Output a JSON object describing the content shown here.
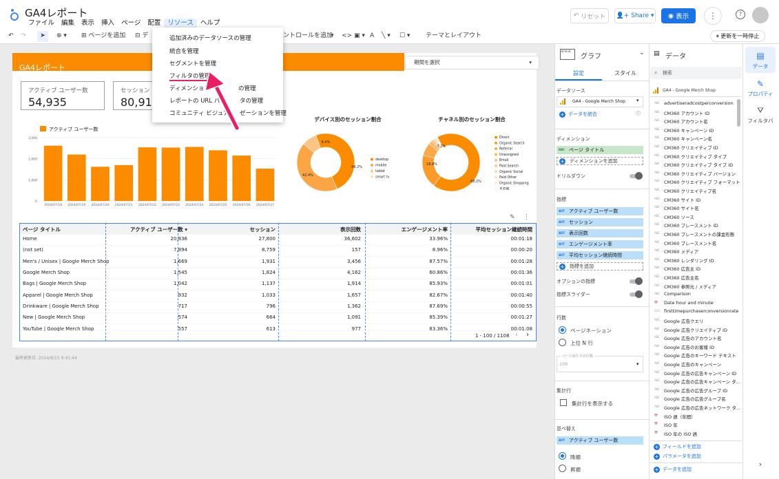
{
  "app": {
    "title": "GA4レポート",
    "menu": [
      "ファイル",
      "編集",
      "表示",
      "挿入",
      "ページ",
      "配置",
      "リソース",
      "ヘルプ"
    ],
    "reset_label": "リセット",
    "share_label": "Share",
    "view_label": "表示",
    "help_icon": "?"
  },
  "toolbar": {
    "add_page": "ページを追加",
    "add_control": "ントロールを追加",
    "theme_layout": "テーマとレイアウト",
    "pause_updates": "更新を一時停止"
  },
  "dropdown": {
    "items": [
      "追加済みのデータソースの管理",
      "統合を管理",
      "セグメントを管理",
      "フィルタの管理",
      "ディメンション",
      "の管理",
      "レポートの URL パ",
      "タの管理",
      "コミュニティ ビジュア",
      "ゼーションを管理"
    ],
    "highlighted_index": 3
  },
  "report": {
    "title": "GA4レポート",
    "date_select": "期間を選択",
    "scorecards": [
      {
        "label": "アクティブ ユーザー数",
        "value": "54,935"
      },
      {
        "label": "セッション",
        "value": "80,914"
      }
    ],
    "last_updated": "最終更新日: 2024/8/15 9:41:44"
  },
  "chart_data": [
    {
      "type": "bar",
      "categories": [
        "2024/07/18",
        "2024/07/19",
        "2024/07/20",
        "2024/07/21",
        "2024/07/22",
        "2024/07/23",
        "2024/07/24",
        "2024/07/25",
        "2024/07/26",
        "2024/07/27"
      ],
      "series": [
        {
          "name": "アクティブ ユーザー数",
          "values": [
            2620,
            2200,
            1620,
            1700,
            2540,
            2530,
            2560,
            2400,
            2150,
            1530
          ]
        }
      ],
      "ylim": [
        0,
        3000
      ],
      "yticks": [
        "3,000",
        "2,000",
        "1,000",
        "0"
      ],
      "color": "#fb8c00"
    },
    {
      "type": "pie",
      "title": "デバイス別のセッション割合",
      "labels": [
        "desktop",
        "mobile",
        "tablet",
        "smart tv"
      ],
      "values": [
        49.2,
        42.4,
        8.4,
        0.0
      ],
      "value_labels": [
        "49.2%",
        "42.4%",
        "8.4%"
      ],
      "colors": [
        "#fb8c00",
        "#fba545",
        "#fbc384",
        "#fde0bf"
      ]
    },
    {
      "type": "pie",
      "title": "チャネル別のセッション割合",
      "labels": [
        "Direct",
        "Organic Search",
        "Referral",
        "Unassigned",
        "Email",
        "Paid Search",
        "Organic Social",
        "Paid Other",
        "Organic Shopping",
        "その他"
      ],
      "values": [
        68.2,
        18.8,
        7.2,
        2.0,
        1.2,
        1.0,
        0.7,
        0.4,
        0.3,
        0.2
      ],
      "value_labels": [
        "68.2%",
        "18.8%",
        "7.2%"
      ],
      "colors": [
        "#fb8c00",
        "#fc9a2a",
        "#fca846",
        "#fcb562",
        "#fcc17c",
        "#fccc94",
        "#fdd7aa",
        "#fde1bf",
        "#fdebd3",
        "#fef4e7"
      ]
    }
  ],
  "table": {
    "headers": [
      "ページ タイトル",
      "アクティブ ユーザー数 ▾",
      "セッション",
      "表示回数",
      "エンゲージメント率",
      "平均セッション継続時間"
    ],
    "rows": [
      [
        "Home",
        "20,836",
        "27,800",
        "36,602",
        "33.96%",
        "00:01:18"
      ],
      [
        "(not set)",
        "7,894",
        "8,759",
        "157",
        "8.96%",
        "00:00:20"
      ],
      [
        "Men's / Unisex | Google Merch Shop",
        "1,669",
        "1,931",
        "3,456",
        "87.57%",
        "00:01:28"
      ],
      [
        "Google Merch Shop",
        "1,545",
        "1,824",
        "4,162",
        "60.86%",
        "00:01:36"
      ],
      [
        "Bags | Google Merch Shop",
        "1,042",
        "1,137",
        "1,914",
        "85.93%",
        "00:01:01"
      ],
      [
        "Apparel | Google Merch Shop",
        "932",
        "1,033",
        "1,657",
        "82.67%",
        "00:01:40"
      ],
      [
        "Drinkware | Google Merch Shop",
        "717",
        "796",
        "1,362",
        "87.69%",
        "00:00:55"
      ],
      [
        "New | Google Merch Shop",
        "574",
        "664",
        "1,091",
        "85.39%",
        "00:01:27"
      ],
      [
        "YouTube | Google Merch Shop",
        "557",
        "613",
        "977",
        "83.36%",
        "00:01:08"
      ]
    ],
    "pagination": "1 - 100 / 1108"
  },
  "chart_panel": {
    "title": "グラフ",
    "tabs": [
      "設定",
      "スタイル"
    ],
    "data_source_label": "データソース",
    "data_source": "GA4 - Google Merch Shop",
    "blend_label": "データを統合",
    "dimension_label": "ディメンション",
    "dimension_chip": "ページ タイトル",
    "add_dimension": "ディメンションを追加",
    "drilldown": "ドリルダウン",
    "metrics_label": "指標",
    "metric_chips": [
      "アクティブ ユーザー数",
      "セッション",
      "表示回数",
      "エンゲージメント率",
      "平均セッション継続時間"
    ],
    "add_metric": "指標を追加",
    "optional_metrics": "オプションの指標",
    "metric_slider": "指標スライダー",
    "rows_label": "行数",
    "pagination_opt": "ページネーション",
    "top_n_opt": "上位 N 行",
    "rows_per_page_label": "ページあたりの行数",
    "rows_per_page": "100",
    "summary_label": "集計行",
    "show_summary": "集計行を表示する",
    "sort_label": "並べ替え",
    "sort_chip": "アクティブ ユーザー数",
    "desc": "降順",
    "asc": "昇順"
  },
  "data_panel": {
    "title": "データ",
    "search_placeholder": "検索",
    "source": "GA4 - Google Merch Shop",
    "fields": [
      [
        "ABC",
        "advertiseradcostperconversion"
      ],
      [
        "ABC",
        "CM360 アカウント ID"
      ],
      [
        "ABC",
        "CM360 アカウント名"
      ],
      [
        "ABC",
        "CM360 キャンペーン ID"
      ],
      [
        "ABC",
        "CM360 キャンペーン名"
      ],
      [
        "ABC",
        "CM360 クリエイティブ ID"
      ],
      [
        "ABC",
        "CM360 クリエイティブ タイプ"
      ],
      [
        "ABC",
        "CM360 クリエイティブ タイプ ID"
      ],
      [
        "ABC",
        "CM360 クリエイティブ バージョン"
      ],
      [
        "ABC",
        "CM360 クリエイティブ フォーマット"
      ],
      [
        "ABC",
        "CM360 クリエイティブ名"
      ],
      [
        "ABC",
        "CM360 サイト ID"
      ],
      [
        "ABC",
        "CM360 サイト名"
      ],
      [
        "ABC",
        "CM360 ソース"
      ],
      [
        "ABC",
        "CM360 プレースメント ID"
      ],
      [
        "ABC",
        "CM360 プレースメントの課金形態"
      ],
      [
        "ABC",
        "CM360 プレースメント名"
      ],
      [
        "ABC",
        "CM360 メディア"
      ],
      [
        "ABC",
        "CM360 レンダリング ID"
      ],
      [
        "ABC",
        "CM360 広告主 ID"
      ],
      [
        "ABC",
        "CM360 広告主名"
      ],
      [
        "ABC",
        "CM360 参照元 / メディア"
      ],
      [
        "ABC",
        "Comparison"
      ],
      [
        "CAL",
        "Date hour and minute"
      ],
      [
        "123",
        "firsttimepurchaserconversionrate"
      ],
      [
        "ABC",
        "Google 広告クエリ"
      ],
      [
        "ABC",
        "Google 広告クリエイティブ ID"
      ],
      [
        "ABC",
        "Google 広告のアカウント名"
      ],
      [
        "ABC",
        "Google 広告のお客様 ID"
      ],
      [
        "ABC",
        "Google 広告のキーワード テキスト"
      ],
      [
        "ABC",
        "Google 広告のキャンペーン"
      ],
      [
        "ABC",
        "Google 広告の広告キャンペーン ID"
      ],
      [
        "ABC",
        "Google 広告の広告キャンペーン タ..."
      ],
      [
        "ABC",
        "Google 広告の広告グループ ID"
      ],
      [
        "ABC",
        "Google 広告の広告グループ名"
      ],
      [
        "ABC",
        "Google 広告の広告ネットワーク タ..."
      ],
      [
        "CAL",
        "ISO 週（年間）"
      ],
      [
        "CAL",
        "ISO 年"
      ],
      [
        "CAL",
        "ISO 年の ISO 週"
      ]
    ],
    "add_field": "フィールドを追加",
    "add_parameter": "パラメータを追加",
    "add_data": "データを追加"
  },
  "side_rail": {
    "data": "データ",
    "properties": "プロパティ",
    "filter": "フィルタバ"
  }
}
